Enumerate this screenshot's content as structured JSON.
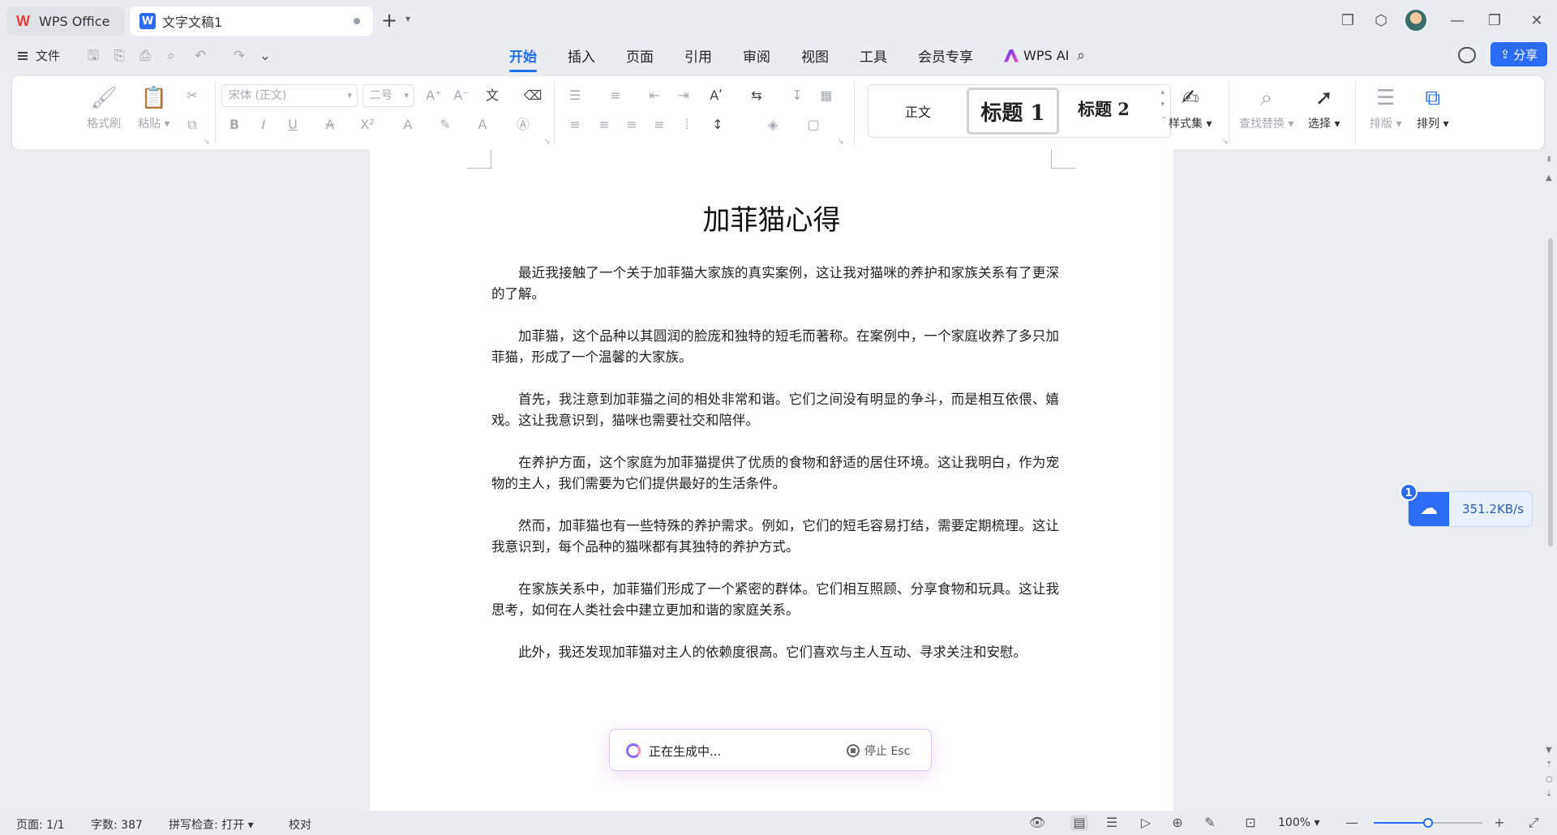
{
  "tabs": {
    "wps_office": "WPS Office",
    "document": "文字文稿1",
    "new_tab": "+"
  },
  "menu": {
    "file": "文件",
    "tabs": [
      "开始",
      "插入",
      "页面",
      "引用",
      "审阅",
      "视图",
      "工具",
      "会员专享"
    ],
    "active_tab": "开始",
    "wps_ai": "WPS AI",
    "share": "分享"
  },
  "ribbon": {
    "format_painter": "格式刷",
    "paste": "粘贴",
    "font_name": "宋体 (正文)",
    "font_size": "二号",
    "styles": {
      "normal": "正文",
      "heading1": "标题 1",
      "heading2": "标题 2"
    },
    "style_set": "样式集",
    "find_replace": "查找替换",
    "select": "选择",
    "layout": "排版",
    "arrange": "排列"
  },
  "document": {
    "title": "加菲猫心得",
    "paragraphs": [
      "最近我接触了一个关于加菲猫大家族的真实案例，这让我对猫咪的养护和家族关系有了更深的了解。",
      "加菲猫，这个品种以其圆润的脸庞和独特的短毛而著称。在案例中，一个家庭收养了多只加菲猫，形成了一个温馨的大家族。",
      "首先，我注意到加菲猫之间的相处非常和谐。它们之间没有明显的争斗，而是相互依偎、嬉戏。这让我意识到，猫咪也需要社交和陪伴。",
      "在养护方面，这个家庭为加菲猫提供了优质的食物和舒适的居住环境。这让我明白，作为宠物的主人，我们需要为它们提供最好的生活条件。",
      "然而，加菲猫也有一些特殊的养护需求。例如，它们的短毛容易打结，需要定期梳理。这让我意识到，每个品种的猫咪都有其独特的养护方式。",
      "在家族关系中，加菲猫们形成了一个紧密的群体。它们相互照顾、分享食物和玩具。这让我思考，如何在人类社会中建立更加和谐的家庭关系。",
      "此外，我还发现加菲猫对主人的依赖度很高。它们喜欢与主人互动、寻求关注和安慰。"
    ]
  },
  "generation": {
    "status": "正在生成中...",
    "stop": "停止 Esc"
  },
  "network": {
    "badge": "1",
    "speed": "351.2KB/s"
  },
  "status": {
    "page": "页面: 1/1",
    "words": "字数: 387",
    "spellcheck": "拼写检查: 打开",
    "proofread": "校对",
    "zoom": "100%",
    "zoom_level": 0.5
  },
  "colors": {
    "accent": "#1e6fe8",
    "share_button": "#2c6cf5"
  }
}
